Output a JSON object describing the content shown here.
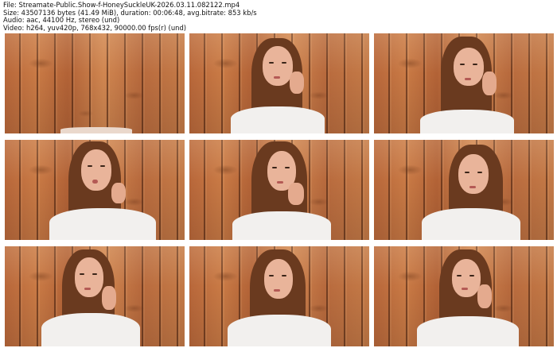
{
  "header": {
    "file": "File: Streamate-Public.Show-f-HoneySuckleUK-2026.03.11.082122.mp4",
    "size": "Size: 43507136 bytes (41.49 MiB), duration: 00:06:48, avg.bitrate: 853 kb/s",
    "audio": "Audio: aac, 44100 Hz, stereo (und)",
    "video": "Video: h264, yuv420p, 768x432, 90000.00 fps(r) (und)"
  },
  "thumbnails": [
    {
      "id": 1,
      "subject": "empty-wood-wall"
    },
    {
      "id": 2,
      "subject": "woman-hand-on-cheek"
    },
    {
      "id": 3,
      "subject": "woman-hand-on-cheek"
    },
    {
      "id": 4,
      "subject": "woman-pouting"
    },
    {
      "id": 5,
      "subject": "woman-hand-on-chin"
    },
    {
      "id": 6,
      "subject": "woman-looking-down"
    },
    {
      "id": 7,
      "subject": "woman-hand-on-chin"
    },
    {
      "id": 8,
      "subject": "woman-centered"
    },
    {
      "id": 9,
      "subject": "woman-hand-on-cheek"
    }
  ]
}
